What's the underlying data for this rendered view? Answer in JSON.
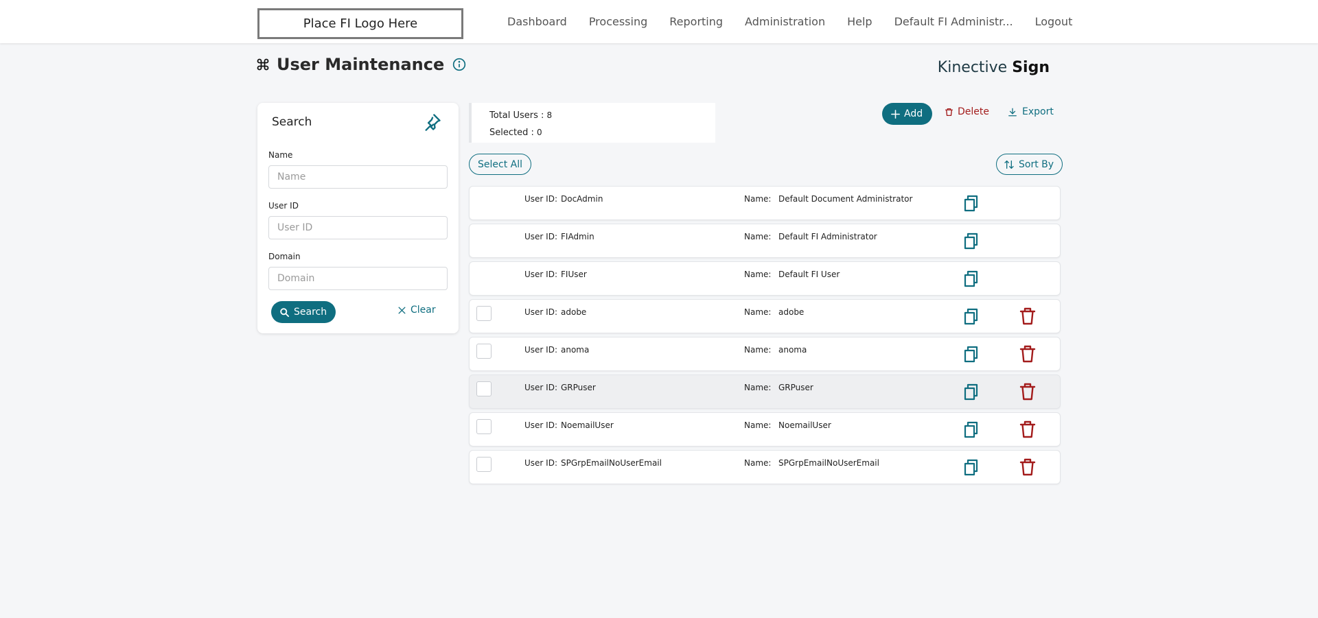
{
  "header": {
    "logo_text": "Place FI Logo Here",
    "nav": [
      "Dashboard",
      "Processing",
      "Reporting",
      "Administration",
      "Help",
      "Default FI Administr...",
      "Logout"
    ]
  },
  "page": {
    "title": "User Maintenance",
    "title_icon": "command-icon",
    "brand_light": "Kinective ",
    "brand_bold": "Sign"
  },
  "search": {
    "title": "Search",
    "name_label": "Name",
    "name_placeholder": "Name",
    "userid_label": "User ID",
    "userid_placeholder": "User ID",
    "domain_label": "Domain",
    "domain_placeholder": "Domain",
    "search_button": "Search",
    "clear_button": "Clear"
  },
  "stats": {
    "total_label": "Total Users : ",
    "total_value": "8",
    "selected_label": "Selected : ",
    "selected_value": "0"
  },
  "toolbar": {
    "add": "Add",
    "delete": "Delete",
    "export": "Export",
    "select_all": "Select All",
    "sort_by": "Sort By"
  },
  "users": {
    "uid_label": "User ID:",
    "name_label": "Name:",
    "rows": [
      {
        "user_id": "DocAdmin",
        "name": "Default Document Administrator"
      },
      {
        "user_id": "FIAdmin",
        "name": "Default FI Administrator"
      },
      {
        "user_id": "FIUser",
        "name": "Default FI User"
      },
      {
        "user_id": "adobe",
        "name": "adobe"
      },
      {
        "user_id": "anoma",
        "name": "anoma"
      },
      {
        "user_id": "GRPuser",
        "name": "GRPuser"
      },
      {
        "user_id": "NoemailUser",
        "name": "NoemailUser"
      },
      {
        "user_id": "SPGrpEmailNoUserEmail",
        "name": "SPGrpEmailNoUserEmail"
      }
    ]
  },
  "colors": {
    "accent": "#0f6e80",
    "danger": "#a31c1c",
    "background": "#f5f6f8"
  }
}
